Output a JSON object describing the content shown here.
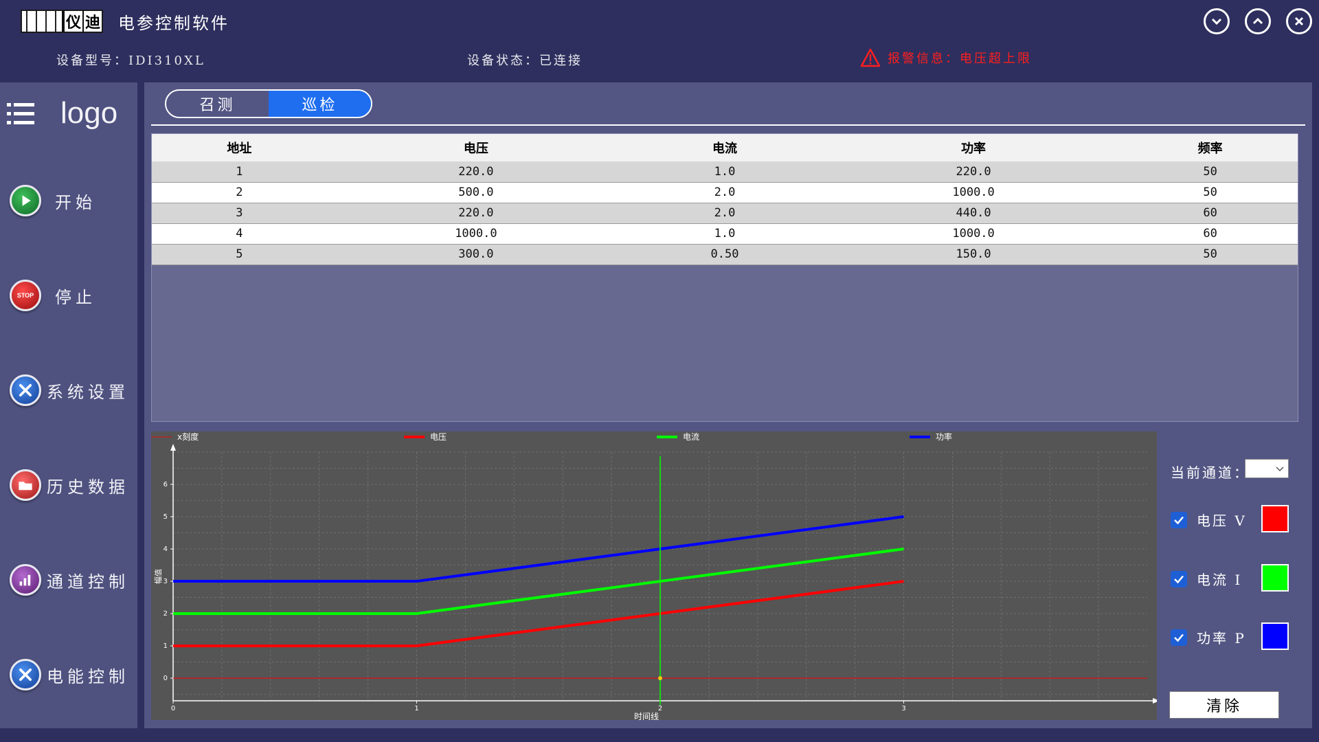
{
  "titlebar": {
    "logo_text_1": "仪",
    "logo_text_2": "迪",
    "title": "电参控制软件",
    "buttons": [
      {
        "name": "minimize",
        "icon": "chevron-down-icon"
      },
      {
        "name": "maximize",
        "icon": "chevron-up-icon"
      },
      {
        "name": "close",
        "icon": "close-icon"
      }
    ]
  },
  "infobar": {
    "model_label": "设备型号：IDI310XL",
    "status_label": "设备状态：已连接",
    "alarm_label": "报警信息：电压超上限",
    "alarm_color": "#ff1e1e"
  },
  "sidebar": {
    "logo": "logo",
    "items": [
      {
        "label": "开始",
        "icon": "play-icon",
        "color": "#1e8a3a"
      },
      {
        "label": "停止",
        "icon": "stop-icon",
        "color": "#c81616",
        "icon_text": "STOP"
      },
      {
        "label": "系统设置",
        "icon": "tools-icon",
        "color": "#1f63c9"
      },
      {
        "label": "历史数据",
        "icon": "folder-icon",
        "color": "#d02a2a"
      },
      {
        "label": "通道控制",
        "icon": "bar-chart-icon",
        "color": "#7a2d91"
      },
      {
        "label": "电能控制",
        "icon": "tools-icon",
        "color": "#1f63c9"
      }
    ]
  },
  "tabs": [
    {
      "label": "召测",
      "active": false
    },
    {
      "label": "巡检",
      "active": true
    }
  ],
  "table": {
    "headers": [
      "地址",
      "电压",
      "电流",
      "功率",
      "频率"
    ],
    "rows": [
      [
        "1",
        "220.0",
        "1.0",
        "220.0",
        "50"
      ],
      [
        "2",
        "500.0",
        "2.0",
        "1000.0",
        "50"
      ],
      [
        "3",
        "220.0",
        "2.0",
        "440.0",
        "60"
      ],
      [
        "4",
        "1000.0",
        "1.0",
        "1000.0",
        "60"
      ],
      [
        "5",
        "300.0",
        "0.50",
        "150.0",
        "50"
      ]
    ]
  },
  "chart_data": {
    "type": "line",
    "xlabel": "时间线",
    "ylabel": "幅值",
    "xlim": [
      0,
      4
    ],
    "ylim": [
      -0.7,
      7
    ],
    "x_ticks": [
      0,
      1,
      2,
      3
    ],
    "y_ticks": [
      0,
      1,
      2,
      3,
      4,
      5,
      6
    ],
    "legend": [
      "x刻度",
      "电压",
      "电流",
      "功率"
    ],
    "grid": true,
    "cursor_x": 2,
    "series": [
      {
        "name": "x刻度",
        "color": "#e01010",
        "x": [
          0,
          4
        ],
        "y": [
          0,
          0
        ]
      },
      {
        "name": "电压",
        "color": "#ff0000",
        "x": [
          0,
          1,
          2,
          3
        ],
        "y": [
          1,
          1,
          2,
          3
        ]
      },
      {
        "name": "电流",
        "color": "#00ff00",
        "x": [
          0,
          1,
          2,
          3
        ],
        "y": [
          2,
          2,
          3,
          4
        ]
      },
      {
        "name": "功率",
        "color": "#0000ff",
        "x": [
          0,
          1,
          2,
          3
        ],
        "y": [
          3,
          3,
          4,
          5
        ]
      }
    ]
  },
  "controls": {
    "channel_label": "当前通道：",
    "channel_value": "",
    "legend": [
      {
        "label": "电压 V",
        "checked": true,
        "color": "#ff0000"
      },
      {
        "label": "电流 I",
        "checked": true,
        "color": "#00ff00"
      },
      {
        "label": "功率 P",
        "checked": true,
        "color": "#0000ff"
      }
    ],
    "clear_label": "清除"
  }
}
